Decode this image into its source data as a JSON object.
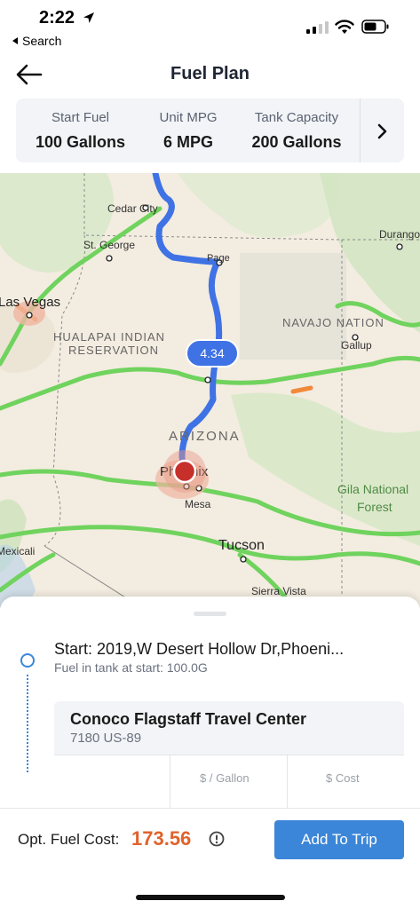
{
  "status_bar": {
    "time": "2:22",
    "back_app": "Search"
  },
  "header": {
    "title": "Fuel Plan"
  },
  "fuel_info": {
    "items": [
      {
        "label": "Start Fuel",
        "value": "100 Gallons"
      },
      {
        "label": "Unit MPG",
        "value": "6 MPG"
      },
      {
        "label": "Tank Capacity",
        "value": "200 Gallons"
      }
    ]
  },
  "map": {
    "labels": {
      "cedar_city": "Cedar City",
      "st_george": "St. George",
      "page": "Page",
      "durango": "Durango",
      "las_vegas": "Las Vegas",
      "hualapai_1": "HUALAPAI INDIAN",
      "hualapai_2": "RESERVATION",
      "navajo": "NAVAJO NATION",
      "gallup": "Gallup",
      "arizona": "ARIZONA",
      "phoenix": "Phoenix",
      "mesa": "Mesa",
      "gila_1": "Gila National",
      "gila_2": "Forest",
      "tucson": "Tucson",
      "mexicali": "Mexicali",
      "sierra_vista": "Sierra Vista"
    },
    "route_badge": "4.34",
    "route_color": "#3f72e4",
    "highway_color": "#6fd35e"
  },
  "trip": {
    "start_title": "Start: 2019,W Desert Hollow Dr,Phoeni...",
    "start_subtitle": "Fuel in tank at start: 100.0G",
    "station": {
      "name": "Conoco Flagstaff Travel Center",
      "address": "7180 US-89",
      "col_price": "$ / Gallon",
      "col_cost": "$ Cost"
    }
  },
  "footer": {
    "cost_label": "Opt. Fuel Cost:",
    "cost_value": "173.56",
    "add_button": "Add To Trip",
    "accent_color": "#e0632a",
    "button_color": "#3b86d8"
  }
}
